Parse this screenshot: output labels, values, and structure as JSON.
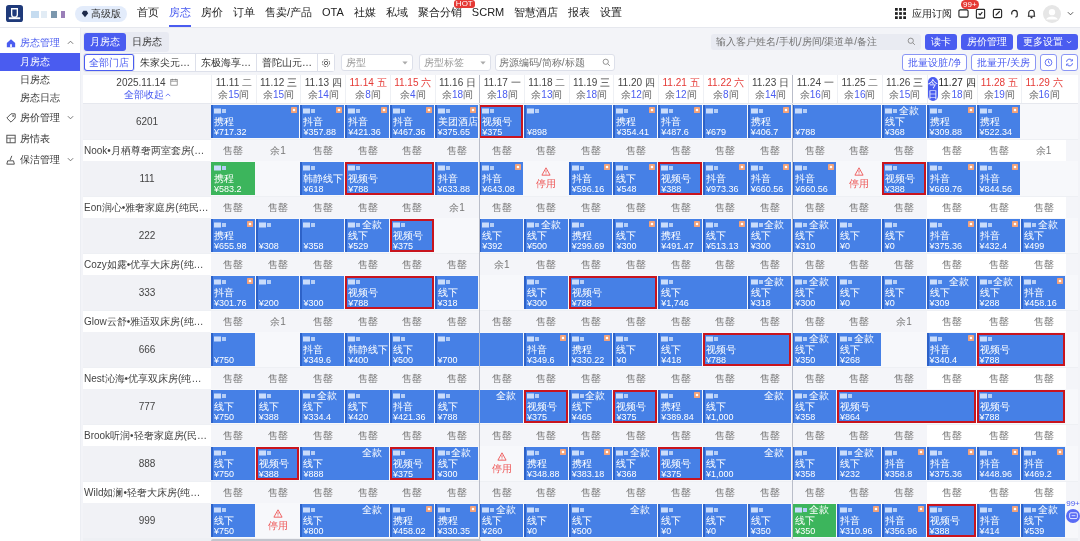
{
  "top_nav": {
    "plan_badge": "高级版",
    "items": [
      {
        "label": "首页",
        "selected": false
      },
      {
        "label": "房态",
        "selected": true
      },
      {
        "label": "房价",
        "selected": false
      },
      {
        "label": "订单",
        "selected": false
      },
      {
        "label": "售卖/产品",
        "selected": false
      },
      {
        "label": "OTA",
        "selected": false
      },
      {
        "label": "社媒",
        "selected": false
      },
      {
        "label": "私域",
        "selected": false
      },
      {
        "label": "聚合分销",
        "selected": false,
        "badge": "HOT"
      },
      {
        "label": "SCRM",
        "selected": false
      },
      {
        "label": "智慧酒店",
        "selected": false
      },
      {
        "label": "报表",
        "selected": false
      },
      {
        "label": "设置",
        "selected": false
      }
    ],
    "apps_label": "应用订阅",
    "message_badge": "99+"
  },
  "sidebar": {
    "items": [
      {
        "kind": "group",
        "label": "房态管理",
        "expanded": true,
        "children": [
          {
            "label": "月房态",
            "selected": true
          },
          {
            "label": "日房态",
            "selected": false
          },
          {
            "label": "房态日志",
            "selected": false
          }
        ]
      },
      {
        "kind": "group",
        "label": "房价管理",
        "expanded": false
      },
      {
        "kind": "link",
        "label": "房情表"
      },
      {
        "kind": "group",
        "label": "保洁管理",
        "expanded": false
      }
    ]
  },
  "view_tabs": [
    {
      "label": "月房态",
      "selected": true
    },
    {
      "label": "日房态",
      "selected": false
    }
  ],
  "guest_search": {
    "placeholder": "输入客户姓名/手机/房间/渠道单/备注"
  },
  "action_buttons": [
    {
      "label": "读卡",
      "kind": "plain"
    },
    {
      "label": "房价管理",
      "kind": "plain"
    },
    {
      "label": "更多设置",
      "kind": "menu"
    }
  ],
  "store_tabs": [
    {
      "label": "全部门店",
      "selected": true
    },
    {
      "label": "朱家尖元…",
      "selected": false
    },
    {
      "label": "东极海享…",
      "selected": false
    },
    {
      "label": "普陀山元…",
      "selected": false
    }
  ],
  "filters": [
    {
      "placeholder": "房型"
    },
    {
      "placeholder": "房型标签"
    }
  ],
  "listing_search": {
    "placeholder": "房源编码/简称/标题"
  },
  "batch_buttons": [
    "批量设脏/净",
    "批量开/关房"
  ],
  "calendar": {
    "date": "2025.11.14",
    "collapse_link": "全部收起",
    "today_label": "今日",
    "days": [
      {
        "date": "11.11",
        "weekday": "二",
        "weekend": false,
        "today": false,
        "remaining": "余**15**间"
      },
      {
        "date": "11.12",
        "weekday": "三",
        "weekend": false,
        "today": false,
        "remaining": "余**15**间"
      },
      {
        "date": "11.13",
        "weekday": "四",
        "weekend": false,
        "today": false,
        "remaining": "余**14**间"
      },
      {
        "date": "11.14",
        "weekday": "五",
        "weekend": true,
        "today": false,
        "remaining": "余**8**间"
      },
      {
        "date": "11.15",
        "weekday": "六",
        "weekend": true,
        "today": false,
        "remaining": "余**4**间"
      },
      {
        "date": "11.16",
        "weekday": "日",
        "weekend": false,
        "today": false,
        "remaining": "余**18**间"
      },
      {
        "date": "11.17",
        "weekday": "一",
        "weekend": false,
        "today": false,
        "remaining": "余**18**间"
      },
      {
        "date": "11.18",
        "weekday": "二",
        "weekend": false,
        "today": false,
        "remaining": "余**13**间"
      },
      {
        "date": "11.19",
        "weekday": "三",
        "weekend": false,
        "today": false,
        "remaining": "余**18**间"
      },
      {
        "date": "11.20",
        "weekday": "四",
        "weekend": false,
        "today": false,
        "remaining": "余**12**间"
      },
      {
        "date": "11.21",
        "weekday": "五",
        "weekend": true,
        "today": false,
        "remaining": "余**12**间"
      },
      {
        "date": "11.22",
        "weekday": "六",
        "weekend": true,
        "today": false,
        "remaining": "余**8**间"
      },
      {
        "date": "11.23",
        "weekday": "日",
        "weekend": false,
        "today": false,
        "remaining": "余**14**间"
      },
      {
        "date": "11.24",
        "weekday": "一",
        "weekend": false,
        "today": false,
        "remaining": "余**16**间"
      },
      {
        "date": "11.25",
        "weekday": "二",
        "weekend": false,
        "today": false,
        "remaining": "余**16**间"
      },
      {
        "date": "11.26",
        "weekday": "三",
        "weekend": false,
        "today": false,
        "remaining": "余**15**间"
      },
      {
        "date": "11.27",
        "weekday": "四",
        "weekend": false,
        "today": true,
        "remaining": "余**18**间"
      },
      {
        "date": "11.28",
        "weekday": "五",
        "weekend": true,
        "today": false,
        "remaining": "余**19**间"
      },
      {
        "date": "11.29",
        "weekday": "六",
        "weekend": true,
        "today": false,
        "remaining": "余**16**间"
      }
    ],
    "rows": [
      {
        "kind": "room",
        "room": "6201",
        "days": [
          {
            "kind": "normal",
            "channel": "携程",
            "price": "¥717.32",
            "corner": true
          },
          {
            "kind": "continued"
          },
          {
            "kind": "normal",
            "channel": "抖音",
            "price": "¥357.88",
            "corner": true
          },
          {
            "kind": "normal",
            "channel": "抖音",
            "price": "¥421.36",
            "corner": true
          },
          {
            "kind": "normal",
            "channel": "抖音",
            "price": "¥467.36",
            "corner": true
          },
          {
            "kind": "normal",
            "channel": "美团酒店",
            "price": "¥375.65",
            "corner": true
          },
          {
            "kind": "highlight",
            "channel": "视频号",
            "price": "¥375",
            "corner": false
          },
          {
            "kind": "normal",
            "price": "¥898",
            "corner": false
          },
          {
            "kind": "continued"
          },
          {
            "kind": "normal",
            "channel": "携程",
            "price": "¥354.41",
            "corner": true
          },
          {
            "kind": "normal",
            "channel": "抖音",
            "price": "¥487.6",
            "corner": true
          },
          {
            "kind": "normal",
            "price": "¥679",
            "corner": false
          },
          {
            "kind": "normal",
            "channel": "携程",
            "price": "¥406.7",
            "corner": true
          },
          {
            "kind": "normal",
            "price": "¥788",
            "corner": false
          },
          {
            "kind": "continued"
          },
          {
            "kind": "normal",
            "tag": "全款",
            "channel": "线下",
            "price": "¥368",
            "corner": false
          },
          {
            "kind": "normal",
            "channel": "携程",
            "price": "¥309.88",
            "corner": true
          },
          {
            "kind": "normal",
            "channel": "携程",
            "price": "¥522.34",
            "corner": true
          },
          {
            "kind": "empty"
          }
        ]
      },
      {
        "kind": "type",
        "name": "Nook•月栖尊奢两室套房(…",
        "cells": [
          "售罄",
          "余1",
          "售罄",
          "售罄",
          "售罄",
          "售罄",
          "售罄",
          "售罄",
          "售罄",
          "售罄",
          "售罄",
          "售罄",
          "售罄",
          "售罄",
          "售罄",
          "售罄",
          "售罄",
          "售罄",
          "余1"
        ]
      },
      {
        "kind": "room",
        "room": "111",
        "days": [
          {
            "kind": "green",
            "channel": "携程",
            "price": "¥583.2",
            "corner": false
          },
          {
            "kind": "empty"
          },
          {
            "kind": "normal",
            "channel": "韩静线下",
            "price": "¥618",
            "corner": false
          },
          {
            "kind": "highlight",
            "channel": "视频号",
            "price": "¥788",
            "corner": false
          },
          {
            "kind": "continued"
          },
          {
            "kind": "normal",
            "channel": "抖音",
            "price": "¥633.88",
            "corner": false
          },
          {
            "kind": "normal",
            "channel": "抖音",
            "price": "¥643.08",
            "corner": true
          },
          {
            "kind": "stopped",
            "label": "停用"
          },
          {
            "kind": "normal",
            "channel": "抖音",
            "price": "¥596.16",
            "corner": true
          },
          {
            "kind": "normal",
            "channel": "线下",
            "price": "¥548",
            "corner": true
          },
          {
            "kind": "highlight",
            "channel": "视频号",
            "price": "¥388",
            "corner": false
          },
          {
            "kind": "normal",
            "channel": "抖音",
            "price": "¥973.36",
            "corner": true
          },
          {
            "kind": "normal",
            "channel": "抖音",
            "price": "¥660.56",
            "corner": true
          },
          {
            "kind": "normal",
            "channel": "抖音",
            "price": "¥660.56",
            "corner": true
          },
          {
            "kind": "stopped",
            "label": "停用"
          },
          {
            "kind": "highlight",
            "channel": "视频号",
            "price": "¥388",
            "corner": false
          },
          {
            "kind": "normal",
            "channel": "抖音",
            "price": "¥669.76",
            "corner": true
          },
          {
            "kind": "normal",
            "channel": "抖音",
            "price": "¥844.56",
            "corner": true
          },
          {
            "kind": "empty"
          }
        ]
      },
      {
        "kind": "type",
        "name": "Eon润心•雅奢家庭房(纯民…",
        "cells": [
          "售罄",
          "售罄",
          "售罄",
          "售罄",
          "售罄",
          "余1",
          "售罄",
          "售罄",
          "售罄",
          "售罄",
          "售罄",
          "售罄",
          "售罄",
          "售罄",
          "售罄",
          "售罄",
          "售罄",
          "售罄",
          "售罄"
        ]
      },
      {
        "kind": "room",
        "room": "222",
        "days": [
          {
            "kind": "normal",
            "channel": "携程",
            "price": "¥655.98",
            "corner": true
          },
          {
            "kind": "normal",
            "price": "¥308",
            "corner": false
          },
          {
            "kind": "normal",
            "price": "¥358",
            "corner": false
          },
          {
            "kind": "normal",
            "tag": "全款",
            "channel": "线下",
            "price": "¥529",
            "corner": false
          },
          {
            "kind": "highlight",
            "channel": "视频号",
            "price": "¥375",
            "corner": false
          },
          {
            "kind": "empty"
          },
          {
            "kind": "normal",
            "channel": "线下",
            "price": "¥392",
            "corner": false
          },
          {
            "kind": "normal",
            "tag": "全款",
            "channel": "线下",
            "price": "¥500",
            "corner": false
          },
          {
            "kind": "normal",
            "channel": "携程",
            "price": "¥299.69",
            "corner": false
          },
          {
            "kind": "normal",
            "channel": "线下",
            "price": "¥300",
            "corner": true
          },
          {
            "kind": "normal",
            "channel": "携程",
            "price": "¥491.47",
            "corner": true
          },
          {
            "kind": "normal",
            "channel": "线下",
            "price": "¥513.13",
            "corner": true
          },
          {
            "kind": "normal",
            "tag": "全款",
            "channel": "线下",
            "price": "¥300",
            "corner": false
          },
          {
            "kind": "normal",
            "tag": "全款",
            "channel": "线下",
            "price": "¥310",
            "corner": false
          },
          {
            "kind": "normal",
            "channel": "线下",
            "price": "¥0",
            "corner": false
          },
          {
            "kind": "normal",
            "channel": "线下",
            "price": "¥0",
            "corner": false
          },
          {
            "kind": "normal",
            "channel": "抖音",
            "price": "¥375.36",
            "corner": true
          },
          {
            "kind": "normal",
            "channel": "抖音",
            "price": "¥432.4",
            "corner": true
          },
          {
            "kind": "normal",
            "tag": "全款",
            "channel": "线下",
            "price": "¥499",
            "corner": false
          }
        ]
      },
      {
        "kind": "type",
        "name": "Cozy如露•优享大床房(纯…",
        "cells": [
          "售罄",
          "售罄",
          "售罄",
          "售罄",
          "售罄",
          "售罄",
          "余1",
          "售罄",
          "售罄",
          "售罄",
          "售罄",
          "售罄",
          "售罄",
          "售罄",
          "售罄",
          "售罄",
          "售罄",
          "售罄",
          "售罄"
        ]
      },
      {
        "kind": "room",
        "room": "333",
        "days": [
          {
            "kind": "normal",
            "channel": "抖音",
            "price": "¥301.76",
            "corner": true
          },
          {
            "kind": "normal",
            "price": "¥200",
            "corner": false
          },
          {
            "kind": "normal",
            "price": "¥300",
            "corner": false
          },
          {
            "kind": "highlight",
            "channel": "视频号",
            "price": "¥788",
            "corner": false
          },
          {
            "kind": "continued"
          },
          {
            "kind": "normal",
            "channel": "线下",
            "price": "¥318",
            "corner": false
          },
          {
            "kind": "empty"
          },
          {
            "kind": "normal",
            "channel": "线下",
            "price": "¥300",
            "corner": false
          },
          {
            "kind": "highlight",
            "channel": "视频号",
            "price": "¥788",
            "corner": false
          },
          {
            "kind": "continued"
          },
          {
            "kind": "normal",
            "channel": "线下",
            "price": "¥1,746",
            "corner": false
          },
          {
            "kind": "continued"
          },
          {
            "kind": "normal",
            "tag": "全款",
            "channel": "线下",
            "price": "¥318",
            "corner": false
          },
          {
            "kind": "normal",
            "tag": "全款",
            "channel": "线下",
            "price": "¥300",
            "corner": false
          },
          {
            "kind": "normal",
            "channel": "线下",
            "price": "¥0",
            "corner": false
          },
          {
            "kind": "normal",
            "channel": "线下",
            "price": "¥0",
            "corner": false
          },
          {
            "kind": "normal",
            "tag": "全款",
            "channel": "线下",
            "price": "¥309",
            "corner": false
          },
          {
            "kind": "normal",
            "tag": "全款",
            "channel": "线下",
            "price": "¥288",
            "corner": false
          },
          {
            "kind": "normal",
            "channel": "抖音",
            "price": "¥458.16",
            "corner": true
          }
        ]
      },
      {
        "kind": "type",
        "name": "Glow云舒•雅适双床房(纯…",
        "cells": [
          "售罄",
          "余1",
          "售罄",
          "售罄",
          "售罄",
          "售罄",
          "售罄",
          "售罄",
          "售罄",
          "售罄",
          "售罄",
          "售罄",
          "售罄",
          "售罄",
          "售罄",
          "余1",
          "售罄",
          "售罄",
          "售罄"
        ]
      },
      {
        "kind": "room",
        "room": "666",
        "days": [
          {
            "kind": "normal",
            "price": "¥750",
            "corner": false
          },
          {
            "kind": "empty"
          },
          {
            "kind": "normal",
            "channel": "抖音",
            "price": "¥349.6",
            "corner": false
          },
          {
            "kind": "normal",
            "channel": "韩静线下",
            "price": "¥400",
            "corner": false
          },
          {
            "kind": "normal",
            "channel": "线下",
            "price": "¥500",
            "corner": false
          },
          {
            "kind": "normal",
            "price": "¥700",
            "corner": false
          },
          {
            "kind": "continued"
          },
          {
            "kind": "normal",
            "channel": "抖音",
            "price": "¥349.6",
            "corner": true
          },
          {
            "kind": "normal",
            "channel": "携程",
            "price": "¥330.22",
            "corner": true
          },
          {
            "kind": "normal",
            "channel": "线下",
            "price": "¥0",
            "corner": false
          },
          {
            "kind": "normal",
            "channel": "线下",
            "price": "¥418",
            "corner": false
          },
          {
            "kind": "highlight",
            "channel": "视频号",
            "price": "¥788",
            "corner": false
          },
          {
            "kind": "continued"
          },
          {
            "kind": "normal",
            "tag": "全款",
            "channel": "线下",
            "price": "¥350",
            "corner": false
          },
          {
            "kind": "normal",
            "tag": "全款",
            "channel": "线下",
            "price": "¥268",
            "corner": false
          },
          {
            "kind": "empty"
          },
          {
            "kind": "normal",
            "channel": "抖音",
            "price": "¥340.4",
            "corner": true
          },
          {
            "kind": "highlight",
            "channel": "视频号",
            "price": "¥788",
            "corner": false
          },
          {
            "kind": "continued"
          }
        ]
      },
      {
        "kind": "type",
        "name": "Nest沁海•优享双床房(纯…",
        "cells": [
          "售罄",
          "售罄",
          "售罄",
          "售罄",
          "售罄",
          "售罄",
          "售罄",
          "售罄",
          "售罄",
          "售罄",
          "售罄",
          "售罄",
          "售罄",
          "售罄",
          "售罄",
          "售罄",
          "售罄",
          "售罄",
          "售罄"
        ]
      },
      {
        "kind": "room",
        "room": "777",
        "days": [
          {
            "kind": "normal",
            "channel": "线下",
            "price": "¥750",
            "corner": false
          },
          {
            "kind": "normal",
            "channel": "线下",
            "price": "¥388",
            "corner": false
          },
          {
            "kind": "normal",
            "tag": "全款",
            "channel": "线下",
            "price": "¥334.4",
            "corner": false
          },
          {
            "kind": "normal",
            "channel": "线下",
            "price": "¥420",
            "corner": false
          },
          {
            "kind": "normal",
            "channel": "抖音",
            "price": "¥421.36",
            "corner": false
          },
          {
            "kind": "normal",
            "tag": "全款",
            "channel": "线下",
            "price": "¥788",
            "corner": false
          },
          {
            "kind": "continued"
          },
          {
            "kind": "highlight",
            "channel": "视频号",
            "price": "¥375",
            "corner": false
          },
          {
            "kind": "normal",
            "tag": "全款",
            "channel": "线下",
            "price": "¥465",
            "corner": false
          },
          {
            "kind": "highlight",
            "channel": "视频号",
            "price": "¥375",
            "corner": false
          },
          {
            "kind": "normal",
            "channel": "携程",
            "price": "¥389.84",
            "corner": true
          },
          {
            "kind": "normal",
            "tag": "全款",
            "channel": "线下",
            "price": "¥1,000",
            "corner": false
          },
          {
            "kind": "continued"
          },
          {
            "kind": "normal",
            "tag": "全款",
            "channel": "线下",
            "price": "¥358",
            "corner": false
          },
          {
            "kind": "highlight",
            "channel": "视频号",
            "price": "¥864",
            "corner": false
          },
          {
            "kind": "continued"
          },
          {
            "kind": "continued"
          },
          {
            "kind": "highlight",
            "channel": "视频号",
            "price": "¥788",
            "corner": false
          },
          {
            "kind": "continued"
          }
        ]
      },
      {
        "kind": "type",
        "name": "Brook听润•轻奢家庭房(民…",
        "cells": [
          "售罄",
          "售罄",
          "售罄",
          "售罄",
          "售罄",
          "售罄",
          "售罄",
          "售罄",
          "售罄",
          "售罄",
          "售罄",
          "售罄",
          "售罄",
          "售罄",
          "售罄",
          "售罄",
          "售罄",
          "售罄",
          "售罄"
        ]
      },
      {
        "kind": "room",
        "room": "888",
        "days": [
          {
            "kind": "normal",
            "channel": "线下",
            "price": "¥750",
            "corner": false
          },
          {
            "kind": "highlight",
            "channel": "视频号",
            "price": "¥388",
            "corner": false
          },
          {
            "kind": "normal",
            "tag": "全款",
            "channel": "线下",
            "price": "¥888",
            "corner": false
          },
          {
            "kind": "continued"
          },
          {
            "kind": "highlight",
            "channel": "视频号",
            "price": "¥375",
            "corner": false
          },
          {
            "kind": "normal",
            "tag": "全款",
            "channel": "线下",
            "price": "¥300",
            "corner": false
          },
          {
            "kind": "stopped",
            "label": "停用"
          },
          {
            "kind": "normal",
            "channel": "携程",
            "price": "¥348.88",
            "corner": true
          },
          {
            "kind": "normal",
            "channel": "携程",
            "price": "¥383.18",
            "corner": true
          },
          {
            "kind": "normal",
            "tag": "全款",
            "channel": "线下",
            "price": "¥368",
            "corner": false
          },
          {
            "kind": "highlight",
            "channel": "视频号",
            "price": "¥375",
            "corner": false
          },
          {
            "kind": "normal",
            "tag": "全款",
            "channel": "线下",
            "price": "¥1,000",
            "corner": false
          },
          {
            "kind": "continued"
          },
          {
            "kind": "normal",
            "channel": "线下",
            "price": "¥358",
            "corner": false
          },
          {
            "kind": "normal",
            "tag": "全款",
            "channel": "线下",
            "price": "¥232",
            "corner": false
          },
          {
            "kind": "normal",
            "channel": "抖音",
            "price": "¥358.8",
            "corner": true
          },
          {
            "kind": "normal",
            "channel": "抖音",
            "price": "¥375.36",
            "corner": true
          },
          {
            "kind": "normal",
            "channel": "抖音",
            "price": "¥448.96",
            "corner": true
          },
          {
            "kind": "normal",
            "channel": "抖音",
            "price": "¥469.2",
            "corner": true
          }
        ]
      },
      {
        "kind": "type",
        "name": "Wild如澜•轻奢大床房(纯…",
        "cells": [
          "售罄",
          "售罄",
          "售罄",
          "售罄",
          "售罄",
          "售罄",
          "售罄",
          "售罄",
          "售罄",
          "售罄",
          "售罄",
          "售罄",
          "售罄",
          "售罄",
          "售罄",
          "售罄",
          "售罄",
          "售罄",
          "售罄"
        ]
      },
      {
        "kind": "room",
        "room": "999",
        "days": [
          {
            "kind": "normal",
            "channel": "线下",
            "price": "¥750",
            "corner": false
          },
          {
            "kind": "stopped",
            "label": "停用"
          },
          {
            "kind": "normal",
            "tag": "全款",
            "channel": "线下",
            "price": "¥800",
            "corner": false
          },
          {
            "kind": "continued"
          },
          {
            "kind": "normal",
            "channel": "携程",
            "price": "¥458.02",
            "corner": true
          },
          {
            "kind": "normal",
            "channel": "携程",
            "price": "¥330.35",
            "corner": true
          },
          {
            "kind": "normal",
            "tag": "全款",
            "channel": "线下",
            "price": "¥260",
            "corner": false
          },
          {
            "kind": "normal",
            "channel": "线下",
            "price": "¥0",
            "corner": false
          },
          {
            "kind": "normal",
            "tag": "全款",
            "channel": "线下",
            "price": "¥500",
            "corner": false
          },
          {
            "kind": "continued"
          },
          {
            "kind": "normal",
            "channel": "线下",
            "price": "¥0",
            "corner": false
          },
          {
            "kind": "normal",
            "channel": "线下",
            "price": "¥0",
            "corner": false
          },
          {
            "kind": "normal",
            "channel": "线下",
            "price": "¥350",
            "corner": false
          },
          {
            "kind": "green",
            "tag": "全款",
            "channel": "线下",
            "price": "¥350",
            "corner": false
          },
          {
            "kind": "normal",
            "channel": "抖音",
            "price": "¥310.96",
            "corner": true
          },
          {
            "kind": "normal",
            "channel": "抖音",
            "price": "¥356.96",
            "corner": true
          },
          {
            "kind": "highlight",
            "channel": "视频号",
            "price": "¥388",
            "corner": false
          },
          {
            "kind": "normal",
            "channel": "抖音",
            "price": "¥414",
            "corner": true
          },
          {
            "kind": "normal",
            "tag": "全款",
            "channel": "线下",
            "price": "¥539",
            "corner": false
          }
        ]
      }
    ]
  },
  "chat_badge": "99+"
}
